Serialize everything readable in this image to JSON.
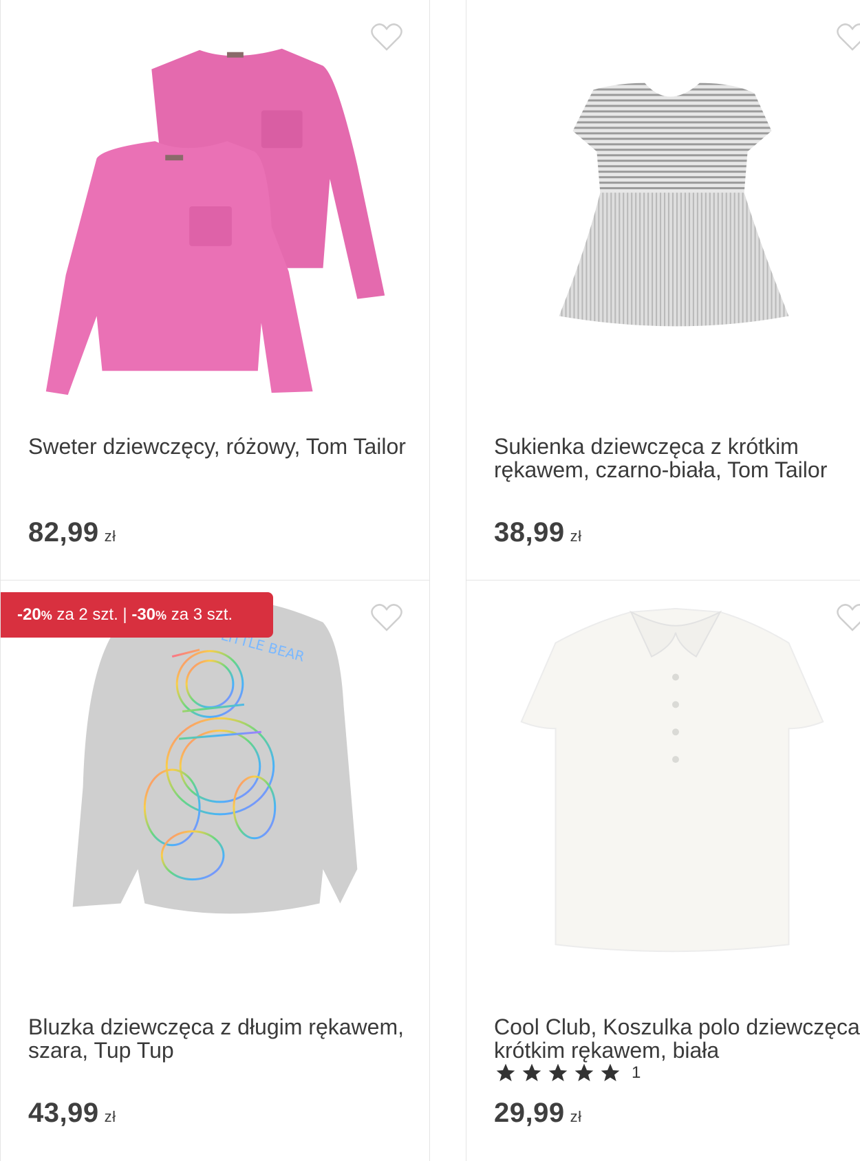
{
  "products": [
    {
      "title": "Sweter dziewczęcy, różowy, Tom Tailor",
      "price": "82,99",
      "currency": "zł",
      "image": "pink-sweater-pair"
    },
    {
      "title": "Sukienka dziewczęca z krótkim rękawem, czarno-biała, Tom Tailor",
      "price": "38,99",
      "currency": "zł",
      "image": "striped-grey-dress"
    },
    {
      "title": "Bluzka dziewczęca z długim rękawem, szara, Tup Tup",
      "price": "43,99",
      "currency": "zł",
      "image": "grey-longsleeve-rainbow-bear",
      "promo": {
        "part1_value": "-20",
        "part1_pct": "%",
        "part1_text": " za 2 szt.",
        "separator": " | ",
        "part2_value": "-30",
        "part2_pct": "%",
        "part2_text": " za 3 szt."
      }
    },
    {
      "title": "Cool Club, Koszulka polo dziewczęca z krótkim rękawem, biała",
      "price": "29,99",
      "currency": "zł",
      "image": "white-polo-shirt",
      "rating": {
        "stars": 5,
        "count": "1"
      }
    }
  ],
  "colors": {
    "promo_red": "#d8303f",
    "heart_stroke": "#cfcfcf",
    "sweater_pink": "#e86fb4",
    "text": "#3a3a3a"
  },
  "icons": {
    "favorite": "heart-outline-icon",
    "rating": "star-icon"
  }
}
